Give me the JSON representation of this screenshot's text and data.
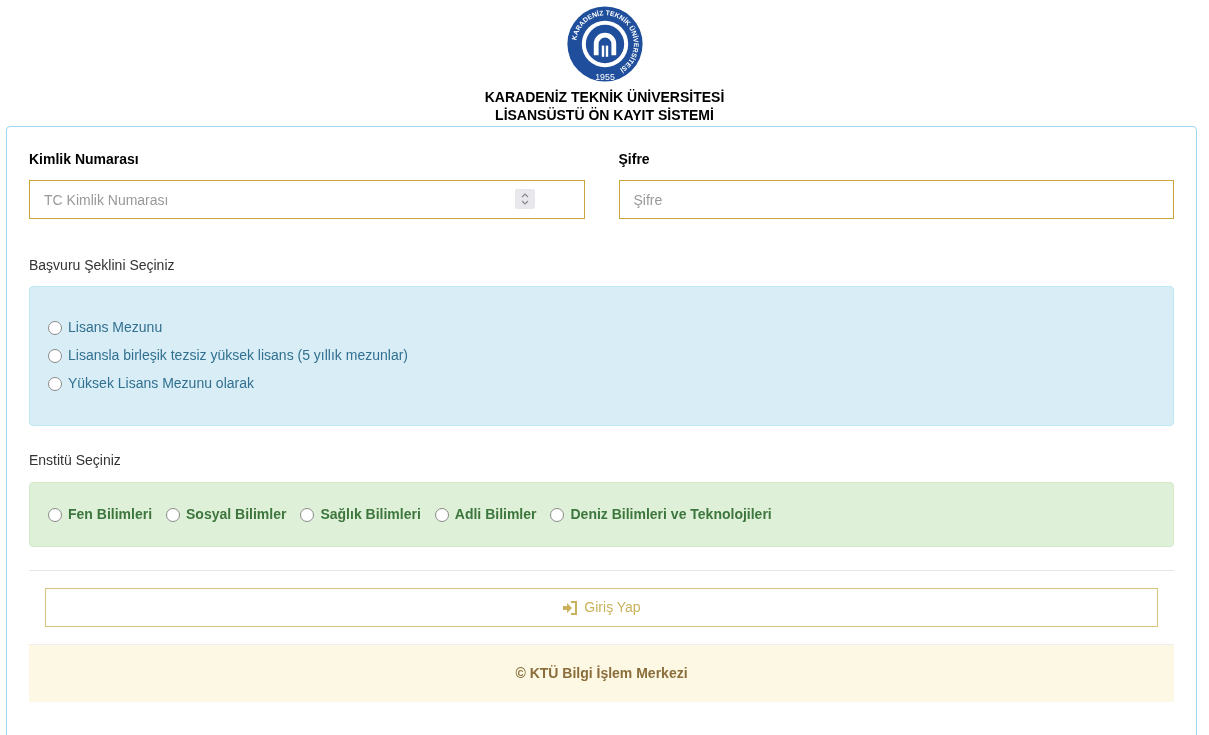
{
  "logo": {
    "ring_text": "KARADENİZ TEKNİK ÜNİVERSİTESİ",
    "year": "1955"
  },
  "header": {
    "title": "KARADENİZ TEKNİK ÜNİVERSİTESİ",
    "subtitle": "LİSANSÜSTÜ ÖN KAYIT SİSTEMİ"
  },
  "fields": [
    {
      "kind": "number",
      "label": "Kimlik Numarası",
      "placeholder": "TC Kimlik Numarası"
    },
    {
      "kind": "password",
      "label": "Şifre",
      "placeholder": "Şifre"
    }
  ],
  "application_type": {
    "label": "Başvuru Şeklini Seçiniz",
    "options": [
      {
        "label": "Lisans Mezunu",
        "selected": false
      },
      {
        "label": "Lisansla birleşik tezsiz yüksek lisans (5 yıllık mezunlar)",
        "selected": false
      },
      {
        "label": "Yüksek Lisans Mezunu olarak",
        "selected": false
      }
    ]
  },
  "institute": {
    "label": "Enstitü Seçiniz",
    "options": [
      {
        "label": "Fen Bilimleri",
        "selected": false
      },
      {
        "label": "Sosyal Bilimler",
        "selected": false
      },
      {
        "label": "Sağlık Bilimleri",
        "selected": false
      },
      {
        "label": "Adli Bilimler",
        "selected": false
      },
      {
        "label": "Deniz Bilimleri ve Teknolojileri",
        "selected": false
      }
    ]
  },
  "login_button": {
    "label": "Giriş Yap"
  },
  "footer": {
    "text": "© KTÜ Bilgi İşlem Merkezi"
  }
}
